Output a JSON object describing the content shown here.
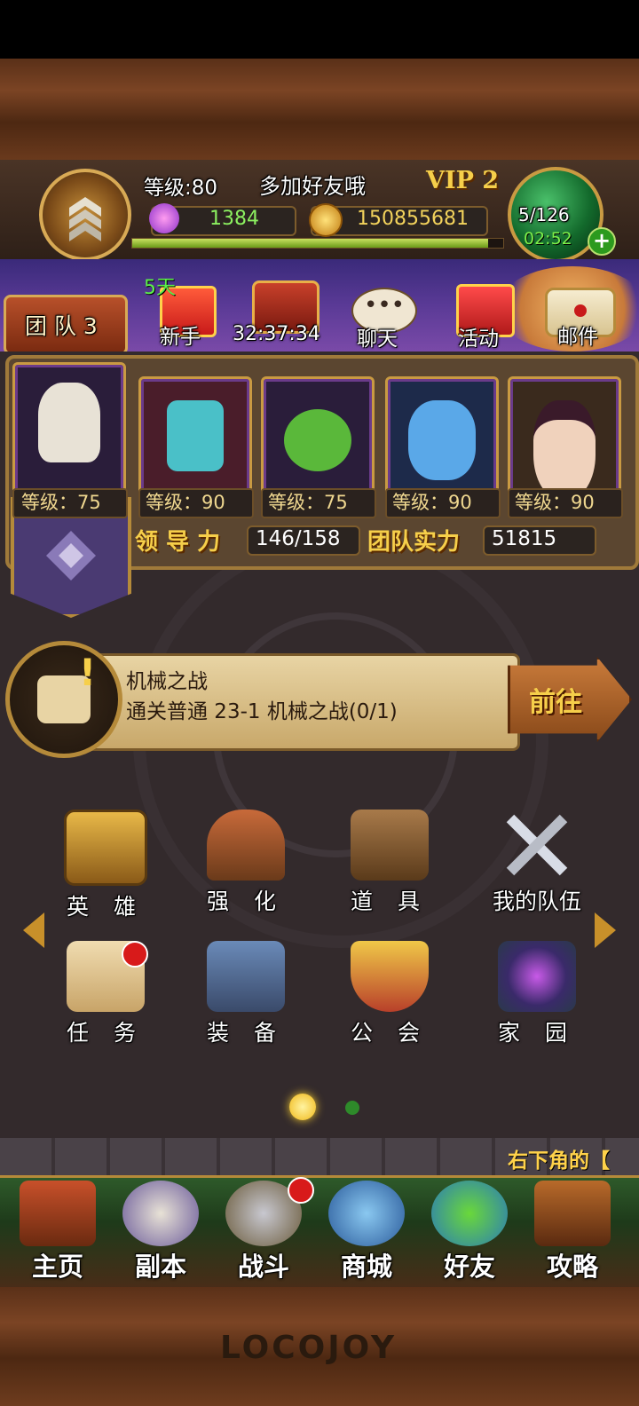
{
  "header": {
    "level_label": "等级:80",
    "player_name": "多加好友哦",
    "vip_label": "VIP 2",
    "gems": "1384",
    "gold": "150855681",
    "stamina": "5/126",
    "stamina_timer": "02:52"
  },
  "team_tab": "团 队 3",
  "top_menu": {
    "newbie_badge": "5天",
    "newbie_label": "新手",
    "chest_timer": "32:37:34",
    "chat_label": "聊天",
    "event_label": "活动",
    "mail_label": "邮件"
  },
  "heroes": [
    {
      "level": "等级：75"
    },
    {
      "level": "等级：90"
    },
    {
      "level": "等级：75"
    },
    {
      "level": "等级：90"
    },
    {
      "level": "等级：90"
    }
  ],
  "stats": {
    "leadership_label": "领 导 力",
    "leadership_value": "146/158",
    "power_label": "团队实力",
    "power_value": "51815"
  },
  "quest": {
    "title": "机械之战",
    "desc": "通关普通 23-1 机械之战(0/1)",
    "go_label": "前往"
  },
  "grid": {
    "row1": [
      "英 雄",
      "强 化",
      "道 具",
      "我的队伍"
    ],
    "row2": [
      "任 务",
      "装 备",
      "公 会",
      "家 园"
    ]
  },
  "ticker": "右下角的【",
  "nav": [
    "主页",
    "副本",
    "战斗",
    "商城",
    "好友",
    "攻略"
  ],
  "brand": "LOCOJOY",
  "colors": {
    "accent_gold": "#e8c35a",
    "gem_green": "#7de04a",
    "ticker_yellow": "#ffd24a"
  }
}
